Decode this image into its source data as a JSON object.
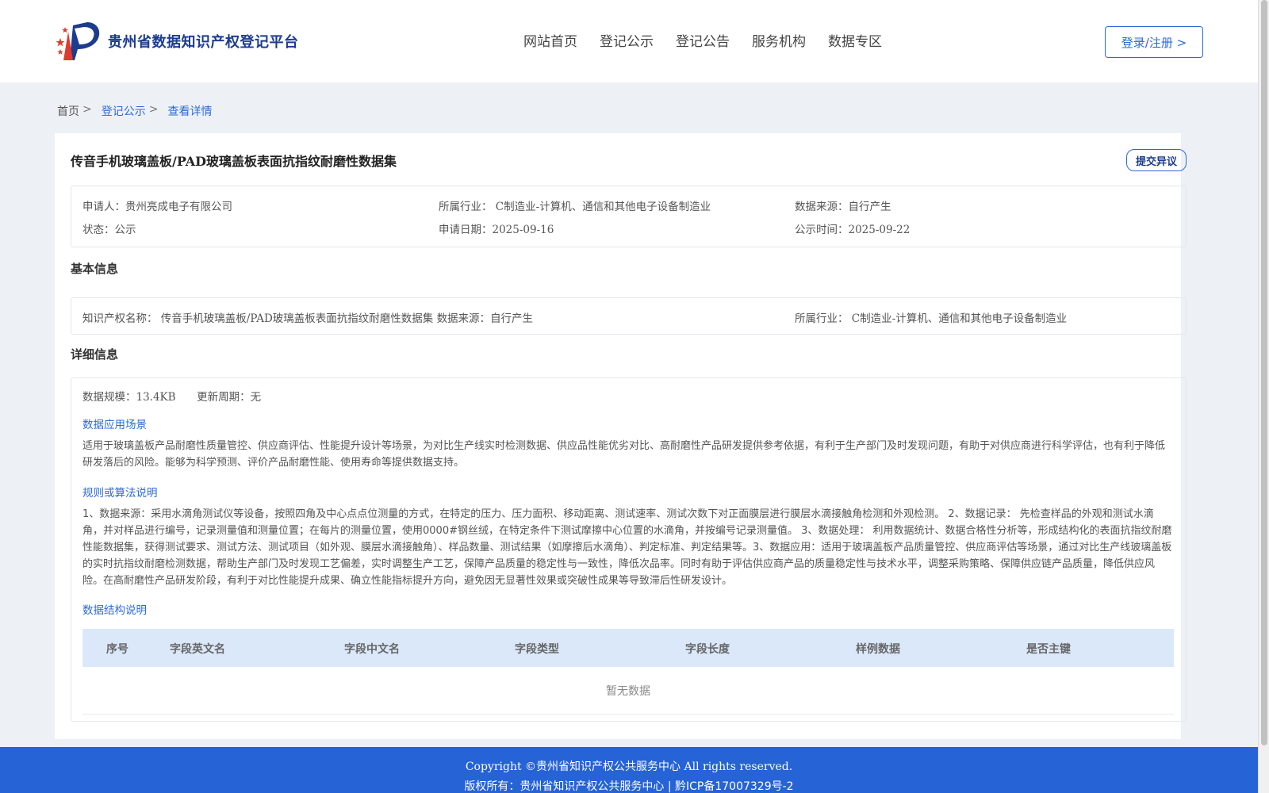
{
  "header": {
    "logo_text": "贵州省数据知识产权登记平台",
    "nav": [
      "网站首页",
      "登记公示",
      "登记公告",
      "服务机构",
      "数据专区"
    ],
    "login_label": "登录/注册 >"
  },
  "breadcrumb": {
    "home": "首页",
    "sep": ">",
    "level1": "登记公示",
    "current": "查看详情"
  },
  "record": {
    "title": "传音手机玻璃盖板/PAD玻璃盖板表面抗指纹耐磨性数据集",
    "objection_label": "提交异议",
    "summary": {
      "applicant_label": "申请人：",
      "applicant": "贵州亮成电子有限公司",
      "industry_label": "所属行业：",
      "industry": "C制造业-计算机、通信和其他电子设备制造业",
      "source_label": "数据来源：",
      "source": "自行产生",
      "status_label": "状态：",
      "status": "公示",
      "apply_date_label": "申请日期：",
      "apply_date": "2025-09-16",
      "publish_date_label": "公示时间：",
      "publish_date": "2025-09-22"
    },
    "basic": {
      "section_title": "基本信息",
      "ip_name_label": "知识产权名称：",
      "ip_name": "传音手机玻璃盖板/PAD玻璃盖板表面抗指纹耐磨性数据集",
      "source_label": "数据来源：",
      "source": "自行产生",
      "industry_label": "所属行业：",
      "industry": "C制造业-计算机、通信和其他电子设备制造业"
    },
    "detail": {
      "section_title": "详细信息",
      "scale_label": "数据规模：",
      "scale": "13.4KB",
      "cycle_label": "更新周期：",
      "cycle": "无",
      "scenario_title": "数据应用场景",
      "scenario_text": "适用于玻璃盖板产品耐磨性质量管控、供应商评估、性能提升设计等场景，为对比生产线实时检测数据、供应品性能优劣对比、高耐磨性产品研发提供参考依据，有利于生产部门及时发现问题，有助于对供应商进行科学评估，也有利于降低研发落后的风险。能够为科学预测、评价产品耐磨性能、使用寿命等提供数据支持。",
      "algo_title": "规则或算法说明",
      "algo_text": "1、数据来源：采用水滴角测试仪等设备，按照四角及中心点点位测量的方式，在特定的压力、压力面积、移动距离、测试速率、测试次数下对正面膜层进行膜层水滴接触角检测和外观检测。 2、数据记录： 先检查样品的外观和测试水滴角，并对样品进行编号，记录测量值和测量位置；在每片的测量位置，使用0000#钢丝绒，在特定条件下测试摩擦中心位置的水滴角，并按编号记录测量值。 3、数据处理： 利用数据统计、数据合格性分析等，形成结构化的表面抗指纹耐磨性能数据集，获得测试要求、测试方法、测试项目（如外观、膜层水滴接触角）、样品数量、测试结果（如摩擦后水滴角）、判定标准、判定结果等。3、数据应用：适用于玻璃盖板产品质量管控、供应商评估等场景，通过对比生产线玻璃盖板的实时抗指纹耐磨检测数据，帮助生产部门及时发现工艺偏差，实时调整生产工艺，保障产品质量的稳定性与一致性，降低次品率。同时有助于评估供应商产品的质量稳定性与技术水平，调整采购策略、保障供应链产品质量，降低供应风险。在高耐磨性产品研发阶段，有利于对比性能提升成果、确立性能指标提升方向，避免因无显著性效果或突破性成果等导致滞后性研发设计。",
      "structure_title": "数据结构说明",
      "table_headers": [
        "序号",
        "字段英文名",
        "字段中文名",
        "字段类型",
        "字段长度",
        "样例数据",
        "是否主键"
      ],
      "empty_text": "暂无数据"
    }
  },
  "footer": {
    "copyright": "Copyright ©贵州省知识产权公共服务中心 All rights reserved.",
    "owner": "版权所有：贵州省知识产权公共服务中心 | 黔ICP备17007329号-2"
  }
}
